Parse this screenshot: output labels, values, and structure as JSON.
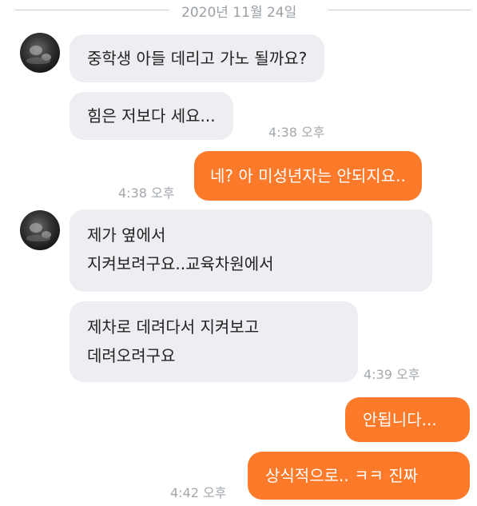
{
  "date_separator": "2020년 11월 24일",
  "colors": {
    "incoming_bubble": "#eceef1",
    "outgoing_bubble": "#fc7a2a",
    "timestamp": "#a3a8ad"
  },
  "messages": [
    {
      "sender": "other",
      "text": "중학생 아들 데리고 가노 될까요?"
    },
    {
      "sender": "other",
      "text": "힘은 저보다 세요...",
      "time": "4:38 오후"
    },
    {
      "sender": "me",
      "text": "네? 아 미성년자는 안되지요..",
      "time": "4:38 오후"
    },
    {
      "sender": "other",
      "lines": [
        "제가  옆에서",
        "지켜보려구요..교육차원에서"
      ]
    },
    {
      "sender": "other",
      "lines": [
        "제차로 데려다서 지켜보고",
        "데려오려구요"
      ],
      "time": "4:39 오후"
    },
    {
      "sender": "me",
      "text": "안됩니다..."
    },
    {
      "sender": "me",
      "text": "상식적으로.. ㅋㅋ 진짜",
      "time": "4:42 오후"
    }
  ]
}
